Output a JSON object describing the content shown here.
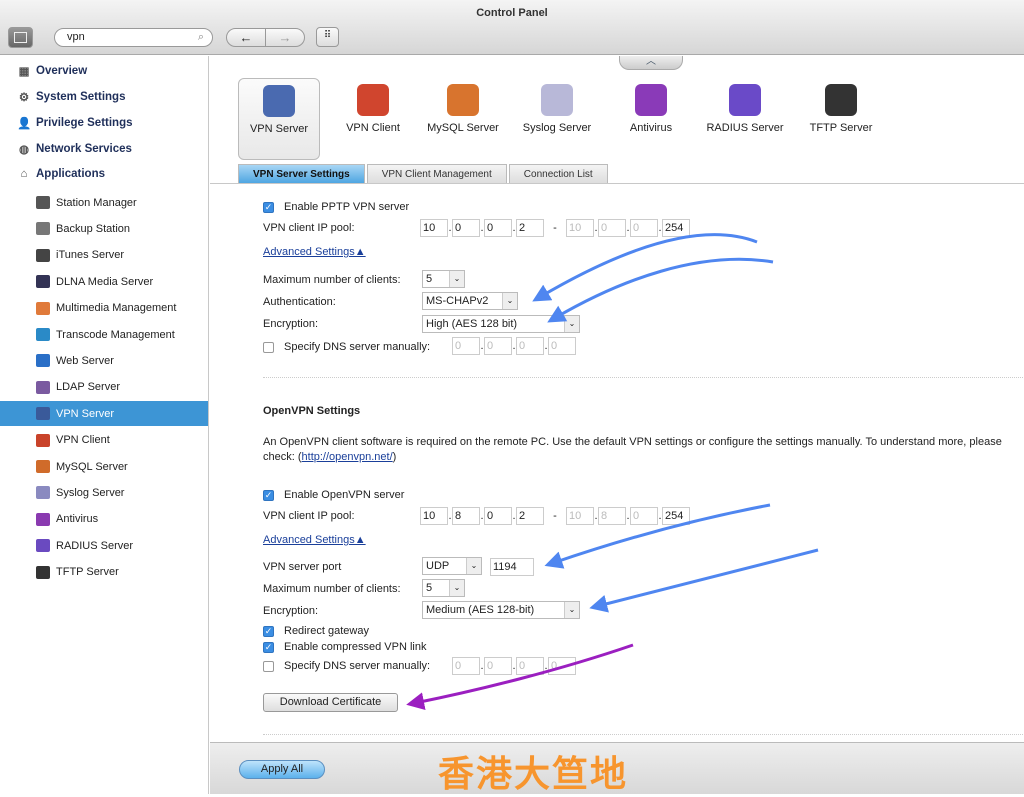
{
  "window": {
    "title": "Control Panel"
  },
  "toolbar": {
    "search_value": "vpn"
  },
  "sidebar": {
    "sections": [
      "Overview",
      "System Settings",
      "Privilege Settings",
      "Network Services",
      "Applications"
    ],
    "items": [
      {
        "label": "Station Manager",
        "color": "#555"
      },
      {
        "label": "Backup Station",
        "color": "#777"
      },
      {
        "label": "iTunes Server",
        "color": "#444"
      },
      {
        "label": "DLNA Media Server",
        "color": "#335"
      },
      {
        "label": "Multimedia Management",
        "color": "#e07a3a"
      },
      {
        "label": "Transcode Management",
        "color": "#2a8ac7"
      },
      {
        "label": "Web Server",
        "color": "#2a6fc7"
      },
      {
        "label": "LDAP Server",
        "color": "#7a5aa0"
      },
      {
        "label": "VPN Server",
        "color": "#3a5a9a"
      },
      {
        "label": "VPN Client",
        "color": "#c9432a"
      },
      {
        "label": "MySQL Server",
        "color": "#d06b2a"
      },
      {
        "label": "Syslog Server",
        "color": "#8a8ac0"
      },
      {
        "label": "Antivirus",
        "color": "#8a3ab0"
      },
      {
        "label": "RADIUS Server",
        "color": "#6a4ac0"
      },
      {
        "label": "TFTP Server",
        "color": "#333"
      }
    ],
    "active": "VPN Server"
  },
  "apps": [
    {
      "label": "VPN Server",
      "color": "#4a6ab0"
    },
    {
      "label": "VPN Client",
      "color": "#d0452e"
    },
    {
      "label": "MySQL Server",
      "color": "#d8742e"
    },
    {
      "label": "Syslog Server",
      "color": "#b8b8d8"
    },
    {
      "label": "Antivirus",
      "color": "#8a3ab8"
    },
    {
      "label": "RADIUS Server",
      "color": "#6a4ac8"
    },
    {
      "label": "TFTP Server",
      "color": "#333"
    }
  ],
  "tabs": [
    "VPN Server Settings",
    "VPN Client Management",
    "Connection List"
  ],
  "pptp": {
    "enable_label": "Enable PPTP VPN server",
    "enabled": true,
    "pool_label": "VPN client IP pool:",
    "pool_start": [
      "10",
      "0",
      "0",
      "2"
    ],
    "pool_end": [
      "10",
      "0",
      "0",
      "254"
    ],
    "advanced": "Advanced Settings▲",
    "max_label": "Maximum number of clients:",
    "max_value": "5",
    "auth_label": "Authentication:",
    "auth_value": "MS-CHAPv2",
    "enc_label": "Encryption:",
    "enc_value": "High (AES 128 bit)",
    "dns_label": "Specify DNS server manually:",
    "dns_enabled": false,
    "dns": [
      "0",
      "0",
      "0",
      "0"
    ]
  },
  "openvpn": {
    "heading": "OpenVPN Settings",
    "desc": "An OpenVPN client software is required on the remote PC. Use the default VPN settings or configure the settings manually. To understand more, please check: (",
    "desc_link": "http://openvpn.net/",
    "desc_end": ")",
    "enable_label": "Enable OpenVPN server",
    "enabled": true,
    "pool_label": "VPN client IP pool:",
    "pool_start": [
      "10",
      "8",
      "0",
      "2"
    ],
    "pool_end": [
      "10",
      "8",
      "0",
      "254"
    ],
    "advanced": "Advanced Settings▲",
    "port_label": "VPN server port",
    "protocol": "UDP",
    "port": "1194",
    "max_label": "Maximum number of clients:",
    "max_value": "5",
    "enc_label": "Encryption:",
    "enc_value": "Medium (AES 128-bit)",
    "redirect_label": "Redirect gateway",
    "redirect": true,
    "compress_label": "Enable compressed VPN link",
    "compress": true,
    "dns_label": "Specify DNS server manually:",
    "dns_enabled": false,
    "dns": [
      "0",
      "0",
      "0",
      "0"
    ],
    "download_label": "Download Certificate"
  },
  "footer": {
    "apply_label": "Apply All",
    "watermark": "香港大笪地"
  },
  "annotation_colors": {
    "blue": "#4f86f0",
    "purple": "#9b1fc0"
  }
}
